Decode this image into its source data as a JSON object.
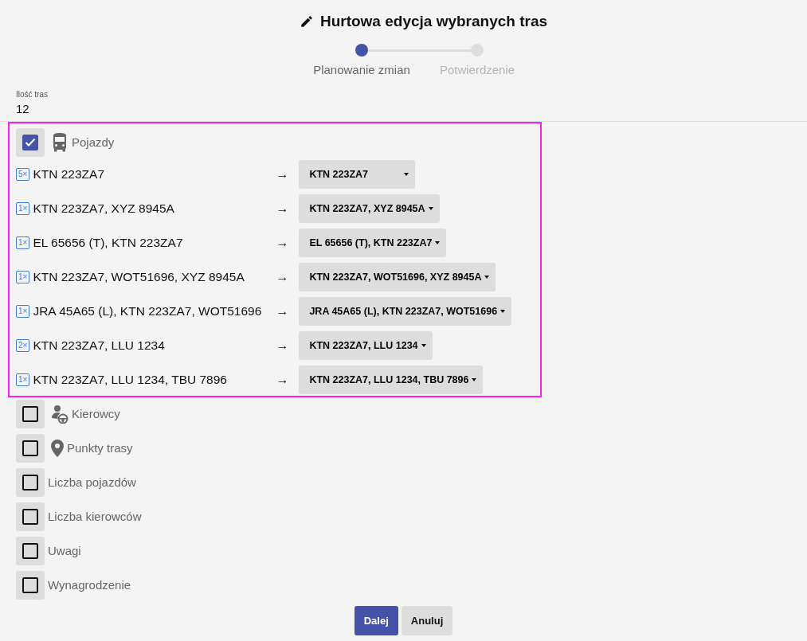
{
  "title": "Hurtowa edycja wybranych tras",
  "steps": [
    {
      "label": "Planowanie zmian",
      "selected": true
    },
    {
      "label": "Potwierdzenie",
      "selected": false
    }
  ],
  "summary": {
    "label": "Ilość tras",
    "value": "12"
  },
  "sections": [
    {
      "label": "Pojazdy",
      "kind": "bus",
      "checked": true,
      "rows": [
        {
          "count": "5×",
          "from": "KTN 223ZA7",
          "arrow": "→",
          "to": "KTN 223ZA7"
        },
        {
          "count": "1×",
          "from": "KTN 223ZA7, XYZ 8945A",
          "arrow": "→",
          "to": "KTN 223ZA7, XYZ 8945A"
        },
        {
          "count": "1×",
          "from": "EL 65656 (T), KTN 223ZA7",
          "arrow": "→",
          "to": "EL 65656 (T), KTN 223ZA7"
        },
        {
          "count": "1×",
          "from": "KTN 223ZA7, WOT51696, XYZ 8945A",
          "arrow": "→",
          "to": "KTN 223ZA7, WOT51696, XYZ 8945A"
        },
        {
          "count": "1×",
          "from": "JRA 45A65 (L), KTN 223ZA7, WOT51696",
          "arrow": "→",
          "to": "JRA 45A65 (L), KTN 223ZA7, WOT51696"
        },
        {
          "count": "2×",
          "from": "KTN 223ZA7, LLU 1234",
          "arrow": "→",
          "to": "KTN 223ZA7, LLU 1234"
        },
        {
          "count": "1×",
          "from": "KTN 223ZA7, LLU 1234, TBU 7896",
          "arrow": "→",
          "to": "KTN 223ZA7, LLU 1234, TBU 7896"
        }
      ]
    },
    {
      "label": "Kierowcy",
      "kind": "driver",
      "checked": false
    },
    {
      "label": "Punkty trasy",
      "kind": "pin",
      "checked": false
    },
    {
      "label": "Liczba pojazdów",
      "kind": "plain",
      "checked": false
    },
    {
      "label": "Liczba kierowców",
      "kind": "plain",
      "checked": false
    },
    {
      "label": "Uwagi",
      "kind": "plain",
      "checked": false
    },
    {
      "label": "Wynagrodzenie",
      "kind": "plain",
      "checked": false
    }
  ],
  "buttons": [
    {
      "label": "Dalej",
      "kind": "primary"
    },
    {
      "label": "Anuluj",
      "kind": "secondary"
    }
  ]
}
